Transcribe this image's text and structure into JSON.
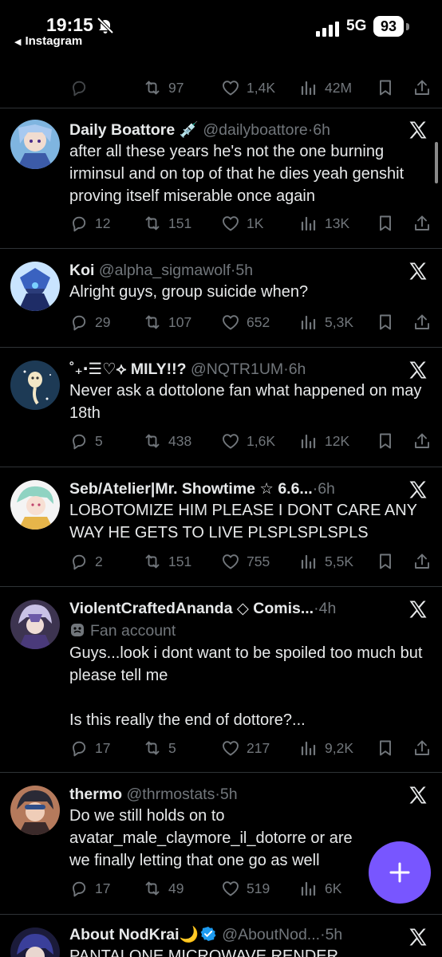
{
  "status_bar": {
    "time": "19:15",
    "back_app": "Instagram",
    "network": "5G",
    "battery": "93"
  },
  "top_partial": {
    "retweets": "97",
    "likes": "1,4K",
    "views": "42M"
  },
  "tweets": [
    {
      "name": "Daily Boattore 💉",
      "handle": "@dailyboattore",
      "dot": "·",
      "age": "6h",
      "text": "after all these years he's not the one burning irminsul and on top of that he dies yeah genshit proving itself miserable once again",
      "replies": "12",
      "retweets": "151",
      "likes": "1K",
      "views": "13K"
    },
    {
      "name": "Koi",
      "handle": "@alpha_sigmawolf",
      "dot": "·",
      "age": "5h",
      "text": "Alright guys, group suicide when?",
      "replies": "29",
      "retweets": "107",
      "likes": "652",
      "views": "5,3K"
    },
    {
      "name": "˚₊‧☰♡⟡ MILY!!?",
      "handle": "@NQTR1UM",
      "dot": "·",
      "age": "6h",
      "text": "Never ask a dottolone fan what happened on may 18th",
      "replies": "5",
      "retweets": "438",
      "likes": "1,6K",
      "views": "12K"
    },
    {
      "name": "Seb/Atelier|Mr. Showtime ☆ 6.6...",
      "handle": "",
      "dot": "·",
      "age": "6h",
      "text": "LOBOTOMIZE HIM PLEASE I DONT CARE ANY WAY HE GETS TO LIVE PLSPLSPLSPLS",
      "replies": "2",
      "retweets": "151",
      "likes": "755",
      "views": "5,5K"
    },
    {
      "name": "ViolentCraftedAnanda ◇ Comis...",
      "handle": "",
      "dot": "·",
      "age": "4h",
      "fan_label": "Fan account",
      "text": "Guys...look i dont want to be spoiled too much but please tell me\n\nIs this really the end of dottore?...",
      "replies": "17",
      "retweets": "5",
      "likes": "217",
      "views": "9,2K"
    },
    {
      "name": "thermo",
      "handle": "@thrmostats",
      "dot": "·",
      "age": "5h",
      "text": "Do we still holds on to avatar_male_claymore_il_dotorre or are we finally letting that one go as well",
      "replies": "17",
      "retweets": "49",
      "likes": "519",
      "views": "6K"
    },
    {
      "name": "About NodKrai🌙",
      "handle": "@AboutNod...",
      "dot": "·",
      "age": "5h",
      "text": "PANTALONE MICROWAVE RENDER"
    }
  ],
  "colors": {
    "background": "#000000",
    "text": "#e7e9ea",
    "secondary": "#71767b",
    "divider": "#2f3336",
    "fab": "#7856ff",
    "verified": "#1d9bf0"
  },
  "icons": [
    "mute-bell-icon",
    "signal-icon",
    "reply-icon",
    "retweet-icon",
    "like-icon",
    "views-icon",
    "bookmark-icon",
    "share-icon",
    "x-logo-icon",
    "compose-plus-icon",
    "verified-badge-icon",
    "mask-icon"
  ]
}
